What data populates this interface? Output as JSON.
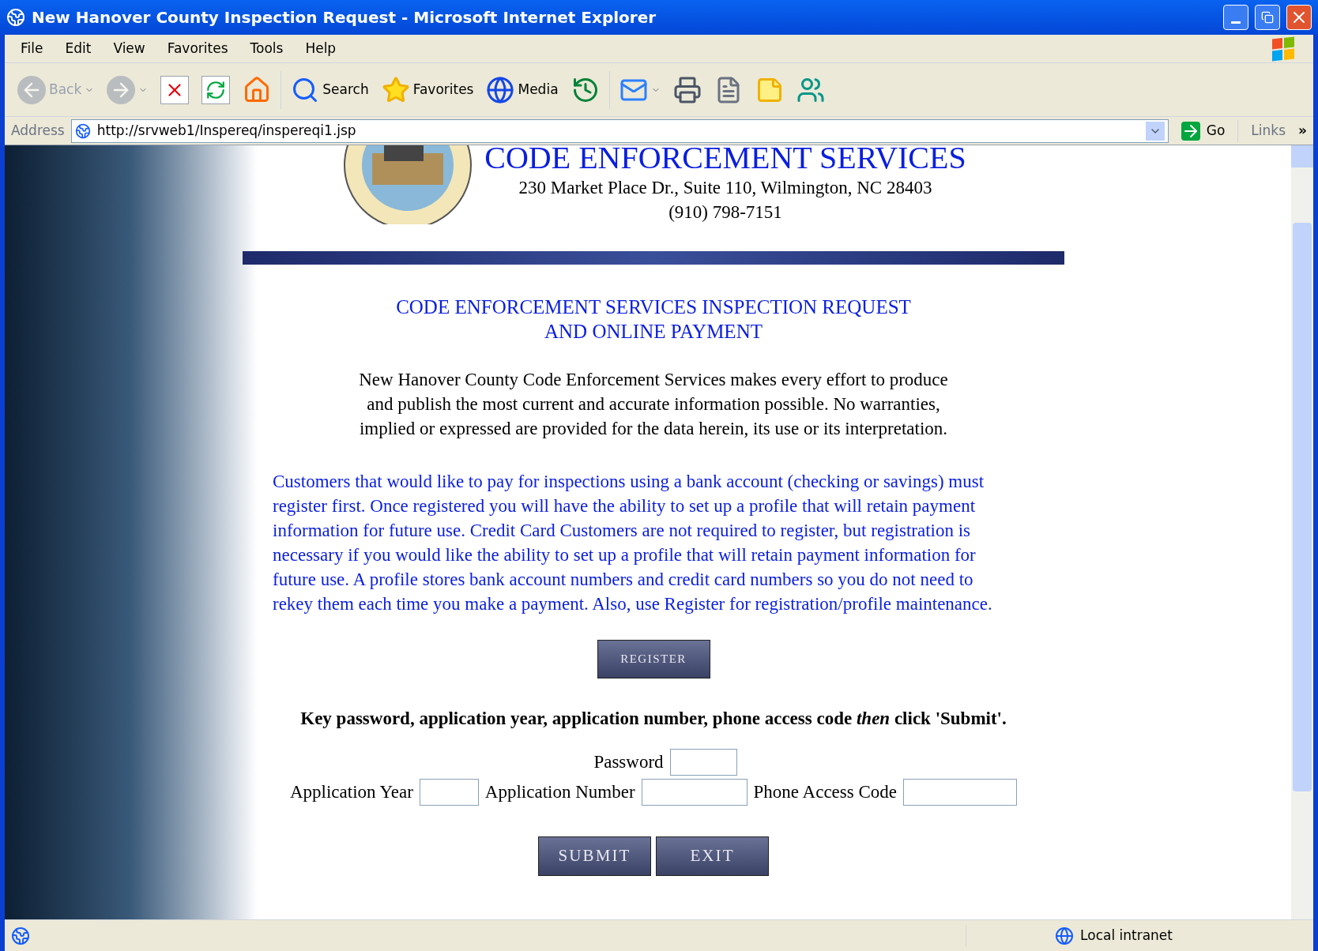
{
  "window": {
    "title": "New Hanover County Inspection Request - Microsoft Internet Explorer"
  },
  "menu": [
    {
      "label": "File"
    },
    {
      "label": "Edit"
    },
    {
      "label": "View"
    },
    {
      "label": "Favorites"
    },
    {
      "label": "Tools"
    },
    {
      "label": "Help"
    }
  ],
  "toolbar": [
    {
      "kind": "back",
      "label": "Back",
      "disabled": true,
      "dropdown": true
    },
    {
      "kind": "forward",
      "disabled": true,
      "dropdown": true
    },
    {
      "kind": "stop",
      "disabled": false,
      "dropdown": false
    },
    {
      "kind": "refresh",
      "disabled": false,
      "dropdown": false
    },
    {
      "kind": "home",
      "disabled": false,
      "dropdown": false
    },
    {
      "kind": "search",
      "label": "Search",
      "disabled": false,
      "dropdown": false
    },
    {
      "kind": "favorites",
      "label": "Favorites",
      "disabled": false,
      "dropdown": false
    },
    {
      "kind": "media",
      "label": "Media",
      "disabled": false,
      "dropdown": false
    },
    {
      "kind": "history",
      "disabled": false,
      "dropdown": false
    },
    {
      "kind": "mail",
      "disabled": false,
      "dropdown": true
    },
    {
      "kind": "print",
      "disabled": false,
      "dropdown": false
    },
    {
      "kind": "edit",
      "disabled": false,
      "dropdown": false
    },
    {
      "kind": "note",
      "disabled": false,
      "dropdown": false
    },
    {
      "kind": "messenger",
      "disabled": false,
      "dropdown": false
    }
  ],
  "address_bar": {
    "label": "Address",
    "url": "http://srvweb1/Inspereq/inspereqi1.jsp",
    "go": "Go",
    "links": "Links",
    "more": "»"
  },
  "page": {
    "agency": "CODE ENFORCEMENT SERVICES",
    "street": "230 Market Place Dr., Suite 110, Wilmington, NC 28403",
    "phone": "(910) 798-7151",
    "heading": [
      "CODE ENFORCEMENT SERVICES INSPECTION REQUEST",
      "AND ONLINE PAYMENT"
    ],
    "disclaimer": "New Hanover County Code Enforcement Services makes every effort to produce and publish the most current and accurate information possible. No warranties, implied or expressed are provided for the data herein, its use or its interpretation.",
    "notice": "Customers that would like to pay for inspections using a bank account (checking or savings) must register first. Once registered you will have the ability to set up a profile that will retain payment information for future use. Credit Card Customers are not required to register, but registration is necessary if you would like the ability to set up a profile that will retain payment information for future use. A profile stores bank account numbers and credit card numbers so you do not need to rekey them each time you make a payment. Also, use Register for registration/profile maintenance.",
    "register_button": "REGISTER",
    "instruction": "Key password, application year, application number, phone access code *then* click 'Submit'.",
    "fields": [
      {
        "label": "Password"
      },
      {
        "label": "Application Year"
      },
      {
        "label": "Application Number"
      },
      {
        "label": "Phone Access Code"
      }
    ],
    "buttons": [
      "SUBMIT",
      "EXIT"
    ]
  },
  "status_bar": {
    "zone": "Local intranet"
  }
}
